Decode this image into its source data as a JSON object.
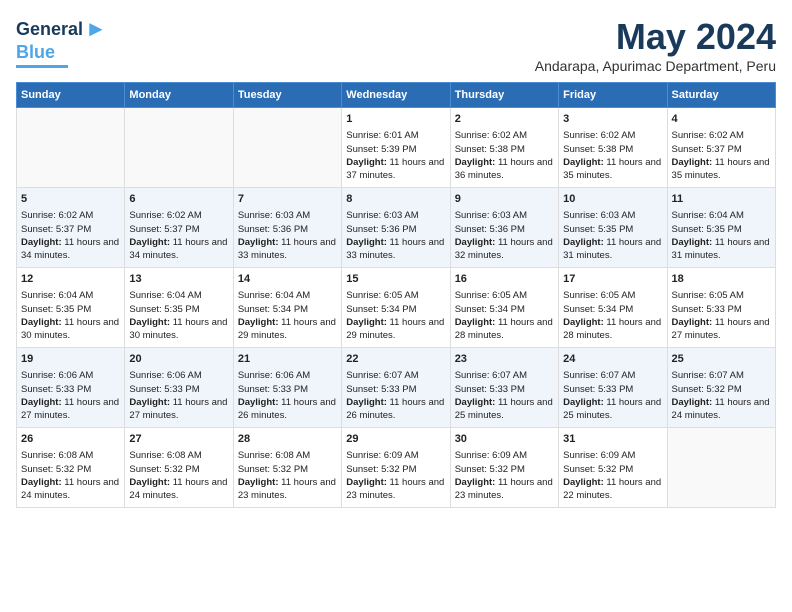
{
  "logo": {
    "text1": "General",
    "text2": "Blue",
    "arrow": "▶"
  },
  "title": "May 2024",
  "location": "Andarapa, Apurimac Department, Peru",
  "days_of_week": [
    "Sunday",
    "Monday",
    "Tuesday",
    "Wednesday",
    "Thursday",
    "Friday",
    "Saturday"
  ],
  "weeks": [
    [
      {
        "day": "",
        "info": ""
      },
      {
        "day": "",
        "info": ""
      },
      {
        "day": "",
        "info": ""
      },
      {
        "day": "1",
        "info": "Sunrise: 6:01 AM\nSunset: 5:39 PM\nDaylight: 11 hours and 37 minutes."
      },
      {
        "day": "2",
        "info": "Sunrise: 6:02 AM\nSunset: 5:38 PM\nDaylight: 11 hours and 36 minutes."
      },
      {
        "day": "3",
        "info": "Sunrise: 6:02 AM\nSunset: 5:38 PM\nDaylight: 11 hours and 35 minutes."
      },
      {
        "day": "4",
        "info": "Sunrise: 6:02 AM\nSunset: 5:37 PM\nDaylight: 11 hours and 35 minutes."
      }
    ],
    [
      {
        "day": "5",
        "info": "Sunrise: 6:02 AM\nSunset: 5:37 PM\nDaylight: 11 hours and 34 minutes."
      },
      {
        "day": "6",
        "info": "Sunrise: 6:02 AM\nSunset: 5:37 PM\nDaylight: 11 hours and 34 minutes."
      },
      {
        "day": "7",
        "info": "Sunrise: 6:03 AM\nSunset: 5:36 PM\nDaylight: 11 hours and 33 minutes."
      },
      {
        "day": "8",
        "info": "Sunrise: 6:03 AM\nSunset: 5:36 PM\nDaylight: 11 hours and 33 minutes."
      },
      {
        "day": "9",
        "info": "Sunrise: 6:03 AM\nSunset: 5:36 PM\nDaylight: 11 hours and 32 minutes."
      },
      {
        "day": "10",
        "info": "Sunrise: 6:03 AM\nSunset: 5:35 PM\nDaylight: 11 hours and 31 minutes."
      },
      {
        "day": "11",
        "info": "Sunrise: 6:04 AM\nSunset: 5:35 PM\nDaylight: 11 hours and 31 minutes."
      }
    ],
    [
      {
        "day": "12",
        "info": "Sunrise: 6:04 AM\nSunset: 5:35 PM\nDaylight: 11 hours and 30 minutes."
      },
      {
        "day": "13",
        "info": "Sunrise: 6:04 AM\nSunset: 5:35 PM\nDaylight: 11 hours and 30 minutes."
      },
      {
        "day": "14",
        "info": "Sunrise: 6:04 AM\nSunset: 5:34 PM\nDaylight: 11 hours and 29 minutes."
      },
      {
        "day": "15",
        "info": "Sunrise: 6:05 AM\nSunset: 5:34 PM\nDaylight: 11 hours and 29 minutes."
      },
      {
        "day": "16",
        "info": "Sunrise: 6:05 AM\nSunset: 5:34 PM\nDaylight: 11 hours and 28 minutes."
      },
      {
        "day": "17",
        "info": "Sunrise: 6:05 AM\nSunset: 5:34 PM\nDaylight: 11 hours and 28 minutes."
      },
      {
        "day": "18",
        "info": "Sunrise: 6:05 AM\nSunset: 5:33 PM\nDaylight: 11 hours and 27 minutes."
      }
    ],
    [
      {
        "day": "19",
        "info": "Sunrise: 6:06 AM\nSunset: 5:33 PM\nDaylight: 11 hours and 27 minutes."
      },
      {
        "day": "20",
        "info": "Sunrise: 6:06 AM\nSunset: 5:33 PM\nDaylight: 11 hours and 27 minutes."
      },
      {
        "day": "21",
        "info": "Sunrise: 6:06 AM\nSunset: 5:33 PM\nDaylight: 11 hours and 26 minutes."
      },
      {
        "day": "22",
        "info": "Sunrise: 6:07 AM\nSunset: 5:33 PM\nDaylight: 11 hours and 26 minutes."
      },
      {
        "day": "23",
        "info": "Sunrise: 6:07 AM\nSunset: 5:33 PM\nDaylight: 11 hours and 25 minutes."
      },
      {
        "day": "24",
        "info": "Sunrise: 6:07 AM\nSunset: 5:33 PM\nDaylight: 11 hours and 25 minutes."
      },
      {
        "day": "25",
        "info": "Sunrise: 6:07 AM\nSunset: 5:32 PM\nDaylight: 11 hours and 24 minutes."
      }
    ],
    [
      {
        "day": "26",
        "info": "Sunrise: 6:08 AM\nSunset: 5:32 PM\nDaylight: 11 hours and 24 minutes."
      },
      {
        "day": "27",
        "info": "Sunrise: 6:08 AM\nSunset: 5:32 PM\nDaylight: 11 hours and 24 minutes."
      },
      {
        "day": "28",
        "info": "Sunrise: 6:08 AM\nSunset: 5:32 PM\nDaylight: 11 hours and 23 minutes."
      },
      {
        "day": "29",
        "info": "Sunrise: 6:09 AM\nSunset: 5:32 PM\nDaylight: 11 hours and 23 minutes."
      },
      {
        "day": "30",
        "info": "Sunrise: 6:09 AM\nSunset: 5:32 PM\nDaylight: 11 hours and 23 minutes."
      },
      {
        "day": "31",
        "info": "Sunrise: 6:09 AM\nSunset: 5:32 PM\nDaylight: 11 hours and 22 minutes."
      },
      {
        "day": "",
        "info": ""
      }
    ]
  ]
}
